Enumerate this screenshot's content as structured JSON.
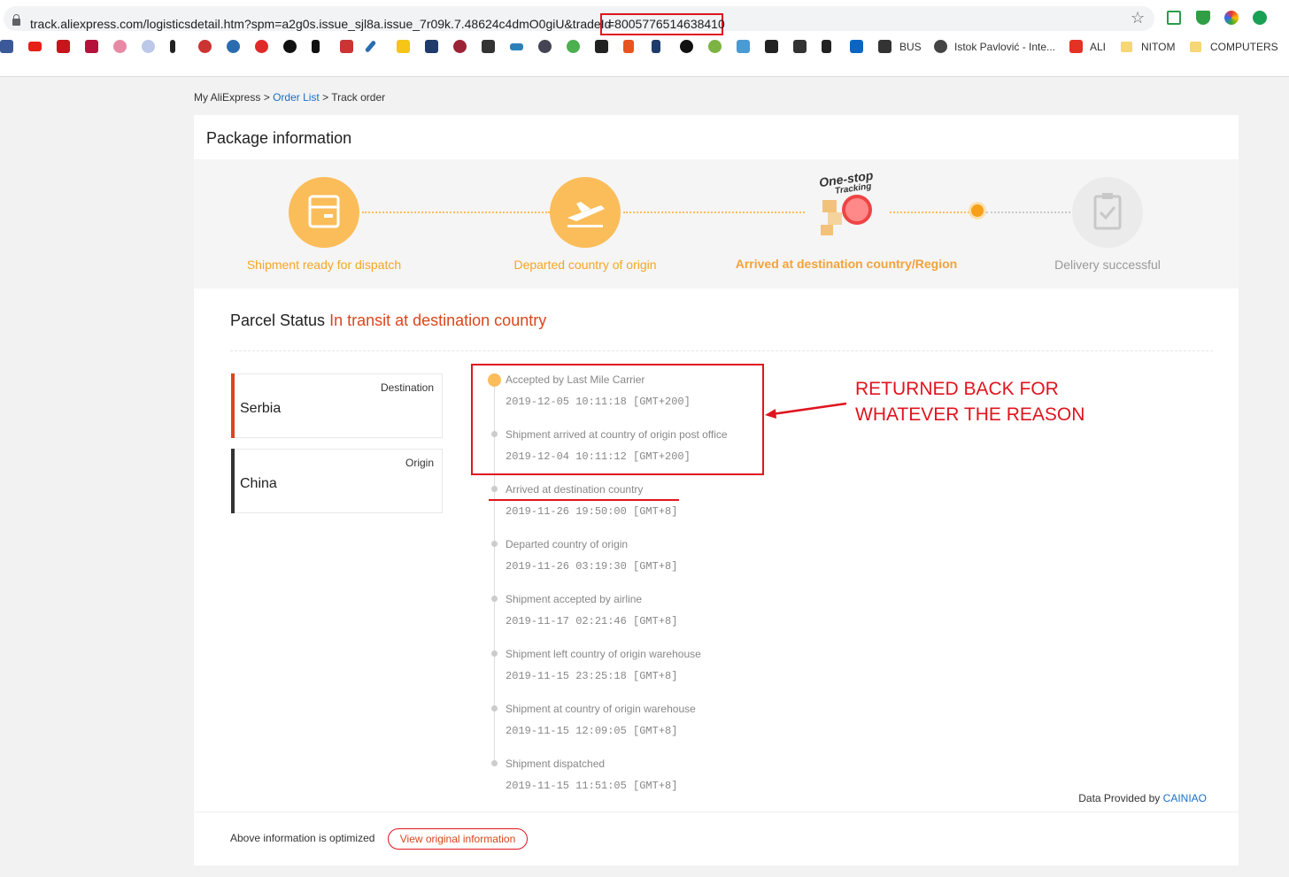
{
  "browser": {
    "url": "track.aliexpress.com/logisticsdetail.htm?spm=a2g0s.issue_sjl8a.issue_7r09k.7.48624c4dmO0giU&tradeId",
    "url_highlight": "=8005776514638410",
    "bookmarks": [
      "BUS",
      "Istok Pavlović - Inte...",
      "ALI",
      "NITOM",
      "COMPUTERS"
    ]
  },
  "breadcrumb": {
    "root": "My AliExpress",
    "sep": ">",
    "link": "Order List",
    "current": "Track order"
  },
  "card": {
    "title": "Package information"
  },
  "steps": [
    {
      "label": "Shipment ready for dispatch",
      "state": "done"
    },
    {
      "label": "Departed country of origin",
      "state": "done"
    },
    {
      "label": "Arrived at destination country/Region",
      "state": "current"
    },
    {
      "label": "Delivery successful",
      "state": "pending"
    }
  ],
  "one_stop": {
    "line1": "One-stop",
    "line2": "Tracking"
  },
  "parcel": {
    "status_label": "Parcel Status",
    "status_value": "In transit at destination country"
  },
  "locations": [
    {
      "tag": "Destination",
      "name": "Serbia",
      "color": "#d9461c"
    },
    {
      "tag": "Origin",
      "name": "China",
      "color": "#333333"
    }
  ],
  "events": [
    {
      "title": "Accepted by Last Mile Carrier",
      "time": "2019-12-05 10:11:18 [GMT+200]"
    },
    {
      "title": "Shipment arrived at country of origin post office",
      "time": "2019-12-04 10:11:12 [GMT+200]"
    },
    {
      "title": "Arrived at destination country",
      "time": "2019-11-26 19:50:00 [GMT+8]"
    },
    {
      "title": "Departed country of origin",
      "time": "2019-11-26 03:19:30 [GMT+8]"
    },
    {
      "title": "Shipment accepted by airline",
      "time": "2019-11-17 02:21:46 [GMT+8]"
    },
    {
      "title": "Shipment left country of origin warehouse",
      "time": "2019-11-15 23:25:18 [GMT+8]"
    },
    {
      "title": "Shipment at country of origin warehouse",
      "time": "2019-11-15 12:09:05 [GMT+8]"
    },
    {
      "title": "Shipment dispatched",
      "time": "2019-11-15 11:51:05 [GMT+8]"
    }
  ],
  "annotation": {
    "line1": "RETURNED BACK FOR",
    "line2": "WHATEVER THE REASON"
  },
  "provided": {
    "prefix": "Data Provided by",
    "link": "CAINIAO"
  },
  "footer": {
    "text": "Above information is optimized",
    "button": "View original information"
  },
  "colors": {
    "accent": "#fbbd5a",
    "status": "#d9461c",
    "annotation": "#e0141e",
    "link": "#1b6fc8"
  }
}
